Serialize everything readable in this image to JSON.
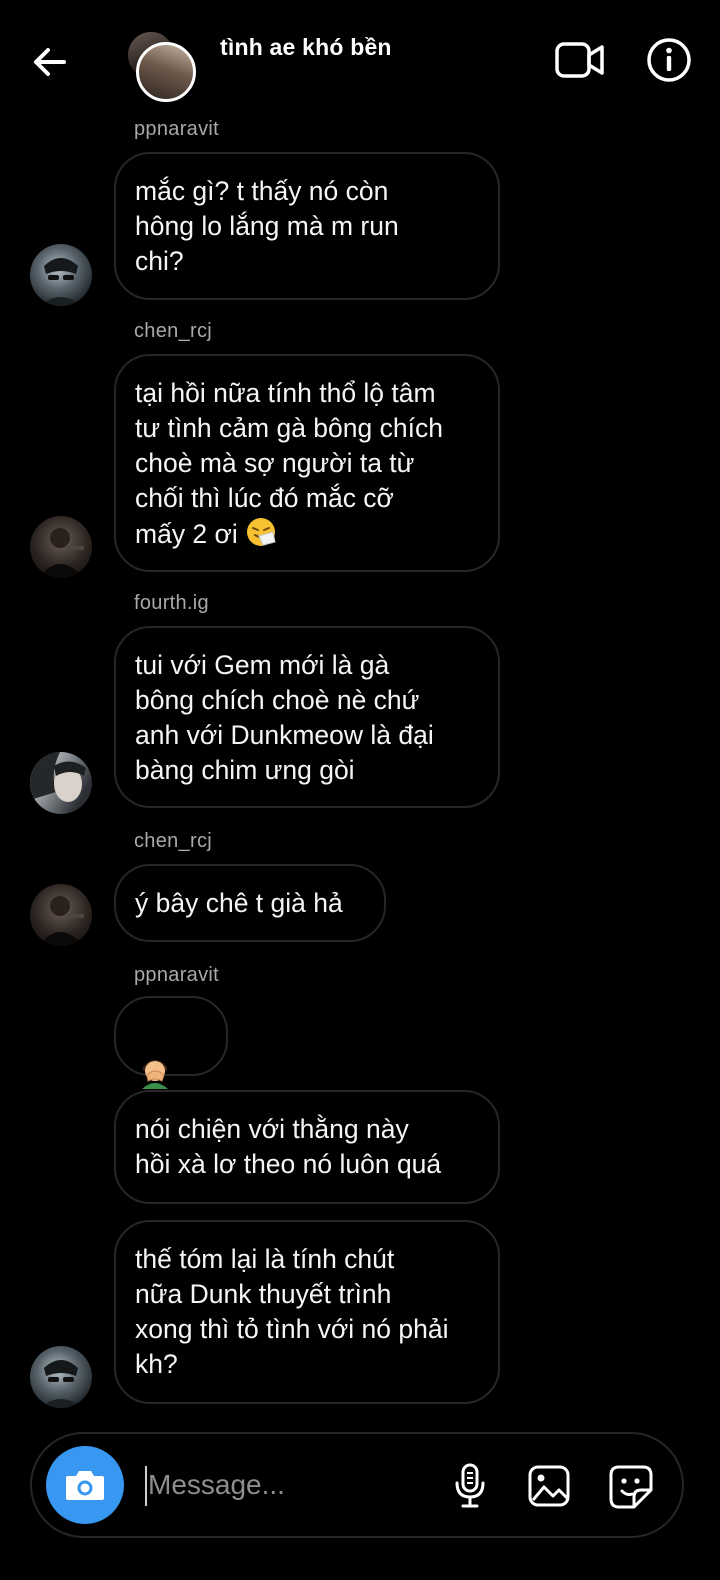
{
  "header": {
    "title": "tình ae khó bền",
    "icons": {
      "back": "arrow-left-icon",
      "video": "video-camera-icon",
      "info": "info-icon"
    }
  },
  "messages": [
    {
      "sender": "ppnaravit",
      "text": "mắc gì? t thấy nó còn\nhông lo lắng mà m run\nchi?"
    },
    {
      "sender": "chen_rcj",
      "text": "tại hồi nữa tính thổ lộ tâm\ntư tình cảm gà bông chích\nchoè mà sợ người ta từ\nchối thì lúc đó mắc cỡ\nmấy 2 ơi",
      "emoji": "sneezing-face"
    },
    {
      "sender": "fourth.ig",
      "text": "tui với Gem mới là gà\nbông chích choè nè chứ\nanh với Dunkmeow là đại\nbàng chim ưng gòi"
    },
    {
      "sender": "chen_rcj",
      "text": "ý bây chê t già hả"
    },
    {
      "sender": "ppnaravit",
      "emoji_only": [
        "man-facepalming",
        "man-facepalming"
      ]
    },
    {
      "text": "nói chiện với thằng này\nhồi xà lơ theo nó luôn quá"
    },
    {
      "text": "thế tóm lại là tính chút\nnữa Dunk thuyết trình\nxong thì tỏ tình với nó phải\nkh?"
    }
  ],
  "composer": {
    "placeholder": "Message...",
    "value": "",
    "icons": {
      "camera": "camera-icon",
      "mic": "microphone-icon",
      "gallery": "image-icon",
      "sticker": "sticker-icon"
    },
    "accent": "#3897f0"
  },
  "colors": {
    "background": "#000000",
    "bubble_border": "#262626",
    "sender_text": "#a8a8a8"
  }
}
